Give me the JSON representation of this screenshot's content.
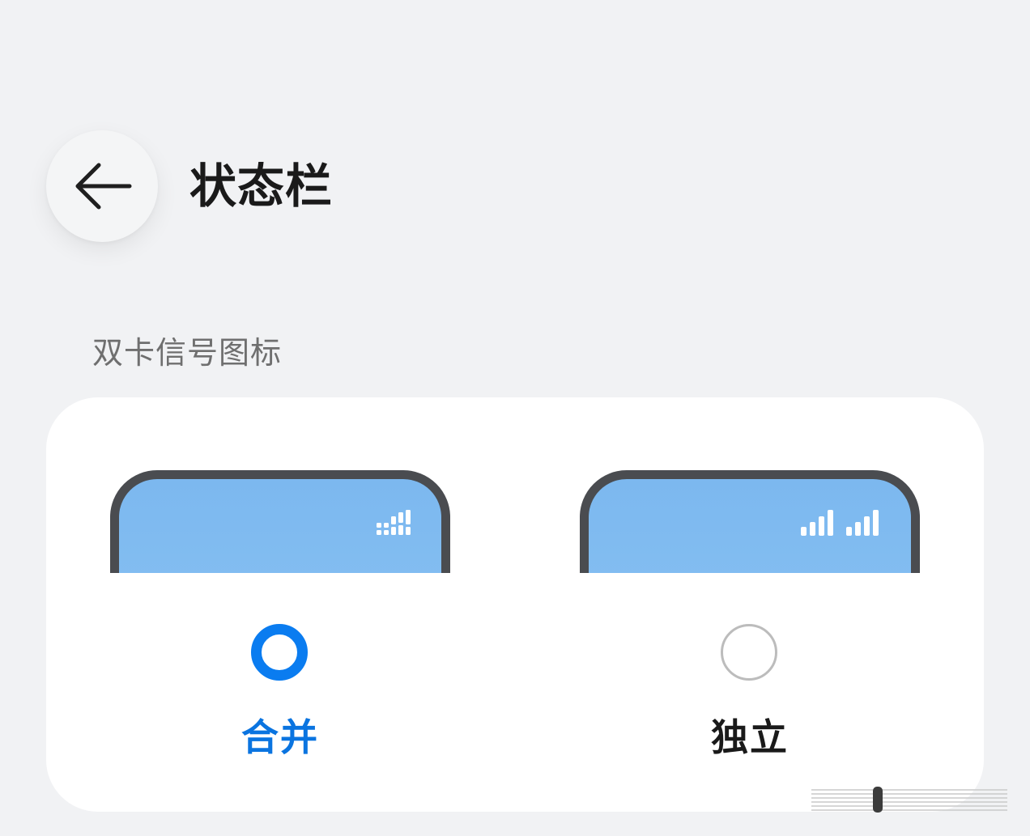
{
  "header": {
    "title": "状态栏",
    "back_icon": "arrow-left-icon"
  },
  "section": {
    "label": "双卡信号图标"
  },
  "options": [
    {
      "label": "合并",
      "selected": true,
      "signal_icon": "merged-dual-signal-icon"
    },
    {
      "label": "独立",
      "selected": false,
      "signal_icon": "separate-dual-signal-icon"
    }
  ],
  "colors": {
    "accent": "#0a7cf0",
    "selected_label": "#0a74e0",
    "background": "#f1f2f4",
    "card": "#ffffff",
    "phone_screen": "#7cb8ef",
    "phone_frame": "#4a4c50",
    "radio_unchecked": "#bcbcbc"
  }
}
